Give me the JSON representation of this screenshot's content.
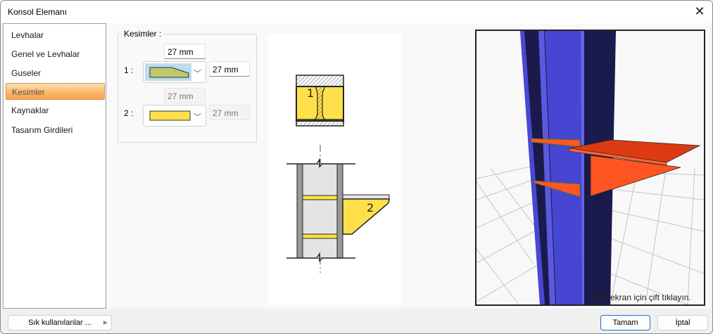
{
  "window": {
    "title": "Konsol Elemanı",
    "close_icon": "close-icon"
  },
  "sidebar": {
    "items": [
      {
        "label": "Levhalar"
      },
      {
        "label": "Genel ve Levhalar"
      },
      {
        "label": "Guseler"
      },
      {
        "label": "Kesimler",
        "selected": true
      },
      {
        "label": "Kaynaklar"
      },
      {
        "label": "Tasarım Girdileri"
      }
    ]
  },
  "kesimler": {
    "group_label": "Kesimler :",
    "row1": {
      "label": "1 :",
      "top_value": "27 mm",
      "right_value": "27 mm",
      "shape": "chamfered-plate",
      "shape_color": "#c0c86a",
      "enabled": true
    },
    "row2": {
      "label": "2 :",
      "top_value": "27 mm",
      "right_value": "27 mm",
      "shape": "rectangular-plate",
      "shape_color": "#ffe04a",
      "enabled": false
    }
  },
  "diagram": {
    "section1_label": "1",
    "section2_label": "2"
  },
  "view3d": {
    "hint": "Tam ekran için çift tıklayın.",
    "column_color": "#4646d2",
    "plate_color": "#ff5522"
  },
  "footer": {
    "favorites_label": "Sık kullanılanlar ...",
    "ok_label": "Tamam",
    "cancel_label": "İptal"
  }
}
